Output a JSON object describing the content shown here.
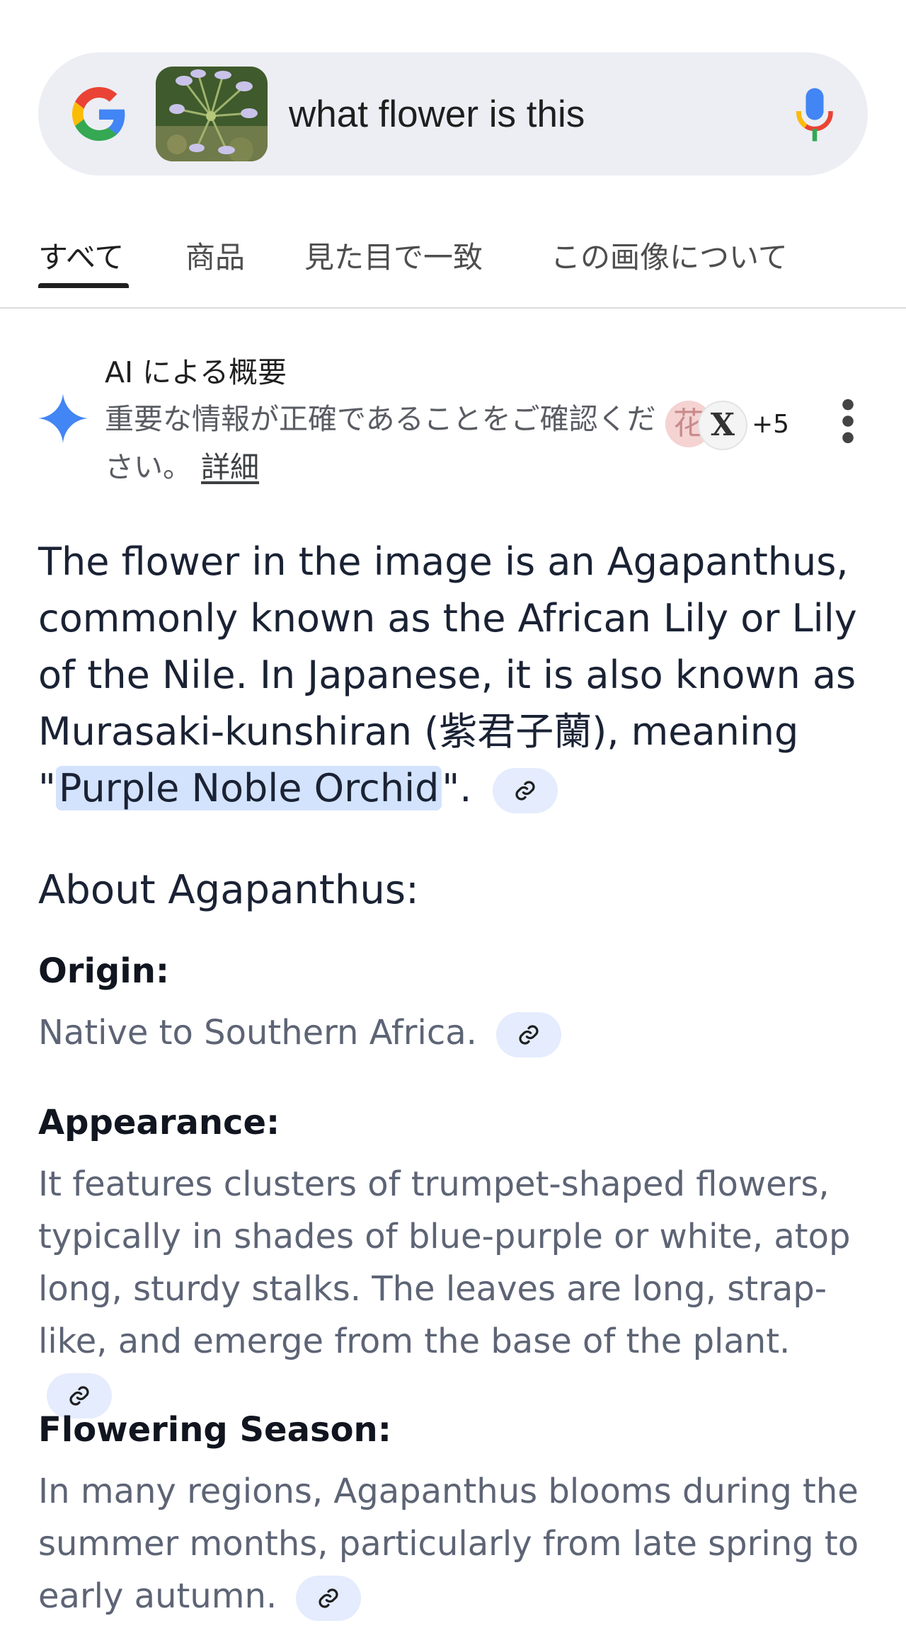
{
  "search": {
    "query": "what flower is this",
    "thumbnail_icon": "flower-thumbnail-image",
    "mic_icon": "mic-icon",
    "logo_icon": "google-g-icon"
  },
  "tabs": [
    {
      "label": "すべて",
      "active": true
    },
    {
      "label": "商品",
      "active": false
    },
    {
      "label": "見た目で一致",
      "active": false
    },
    {
      "label": "この画像について",
      "active": false
    }
  ],
  "ai_overview": {
    "title": "AI による概要",
    "note": "重要な情報が正確であることをご確認ください。",
    "more_link": "詳細",
    "source_a": "花",
    "source_b": "X",
    "source_count": "+5",
    "colors": {
      "spark": "#4285f4",
      "highlight": "#d3e3fd",
      "chip": "#e4ecfd"
    }
  },
  "summary": {
    "before": "The flower in the image is an Agapanthus, commonly known as the African Lily or Lily of the Nile. In Japanese, it is also known as Murasaki-kunshiran (紫君子蘭), meaning \"",
    "highlight": "Purple Noble Orchid",
    "after": "\"."
  },
  "about": {
    "heading": "About Agapanthus:",
    "sections": [
      {
        "title": "Origin:",
        "text": "Native to Southern Africa."
      },
      {
        "title": "Appearance:",
        "text": "It features clusters of trumpet-shaped flowers, typically in shades of blue-purple or white, atop long, sturdy stalks. The leaves are long, strap-like, and emerge from the base of the plant."
      },
      {
        "title": "Flowering Season:",
        "text": "In many regions, Agapanthus blooms during the summer months, particularly from late spring to early autumn."
      }
    ]
  }
}
